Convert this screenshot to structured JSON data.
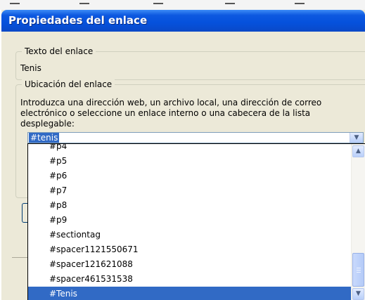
{
  "dialog": {
    "title": "Propiedades del enlace"
  },
  "link_text_group": {
    "legend": "Texto del enlace",
    "value": "Tenis"
  },
  "location_group": {
    "legend": "Ubicación del enlace",
    "instructions": [
      "Introduzca una dirección web, un archivo local, una dirección de correo",
      "electrónico o seleccione un enlace interno o una cabecera de la lista",
      "desplegable:"
    ],
    "combo_value": "#tenis"
  },
  "dropdown": {
    "items": [
      "#p4",
      "#p5",
      "#p6",
      "#p7",
      "#p8",
      "#p9",
      "#sectiontag",
      "#spacer1121550671",
      "#spacer121621088",
      "#spacer461531538",
      "#Tenis"
    ],
    "selected_item": "#Tenis"
  },
  "icons": {
    "combo_arrow": "chevron-down-icon",
    "scroll_up": "chevron-up-icon",
    "scroll_down": "chevron-down-icon"
  },
  "colors": {
    "titlebar": "#0a52dd",
    "selection": "#316ac5",
    "dialog_background": "#ece9d8"
  }
}
